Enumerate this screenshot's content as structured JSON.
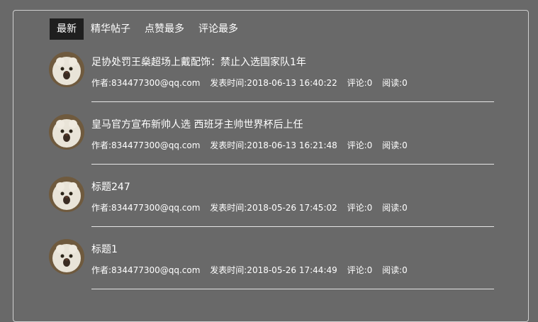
{
  "tabs": [
    {
      "label": "最新",
      "active": true
    },
    {
      "label": "精华帖子",
      "active": false
    },
    {
      "label": "点赞最多",
      "active": false
    },
    {
      "label": "评论最多",
      "active": false
    }
  ],
  "posts": [
    {
      "title": "足协处罚王燊超场上戴配饰：禁止入选国家队1年",
      "author": "作者:834477300@qq.com",
      "time": "发表时间:2018-06-13 16:40:22",
      "comments": "评论:0",
      "reads": "阅读:0"
    },
    {
      "title": "皇马官方宣布新帅人选 西班牙主帅世界杯后上任",
      "author": "作者:834477300@qq.com",
      "time": "发表时间:2018-06-13 16:21:48",
      "comments": "评论:0",
      "reads": "阅读:0"
    },
    {
      "title": "标题247",
      "author": "作者:834477300@qq.com",
      "time": "发表时间:2018-05-26 17:45:02",
      "comments": "评论:0",
      "reads": "阅读:0"
    },
    {
      "title": "标题1",
      "author": "作者:834477300@qq.com",
      "time": "发表时间:2018-05-26 17:44:49",
      "comments": "评论:0",
      "reads": "阅读:0"
    }
  ],
  "colors": {
    "background": "#696969",
    "active_tab": "#1f1f1f",
    "divider": "#e6e6e6",
    "border": "#cfcfcf"
  },
  "icons": {
    "avatar": "user-avatar-icon"
  }
}
